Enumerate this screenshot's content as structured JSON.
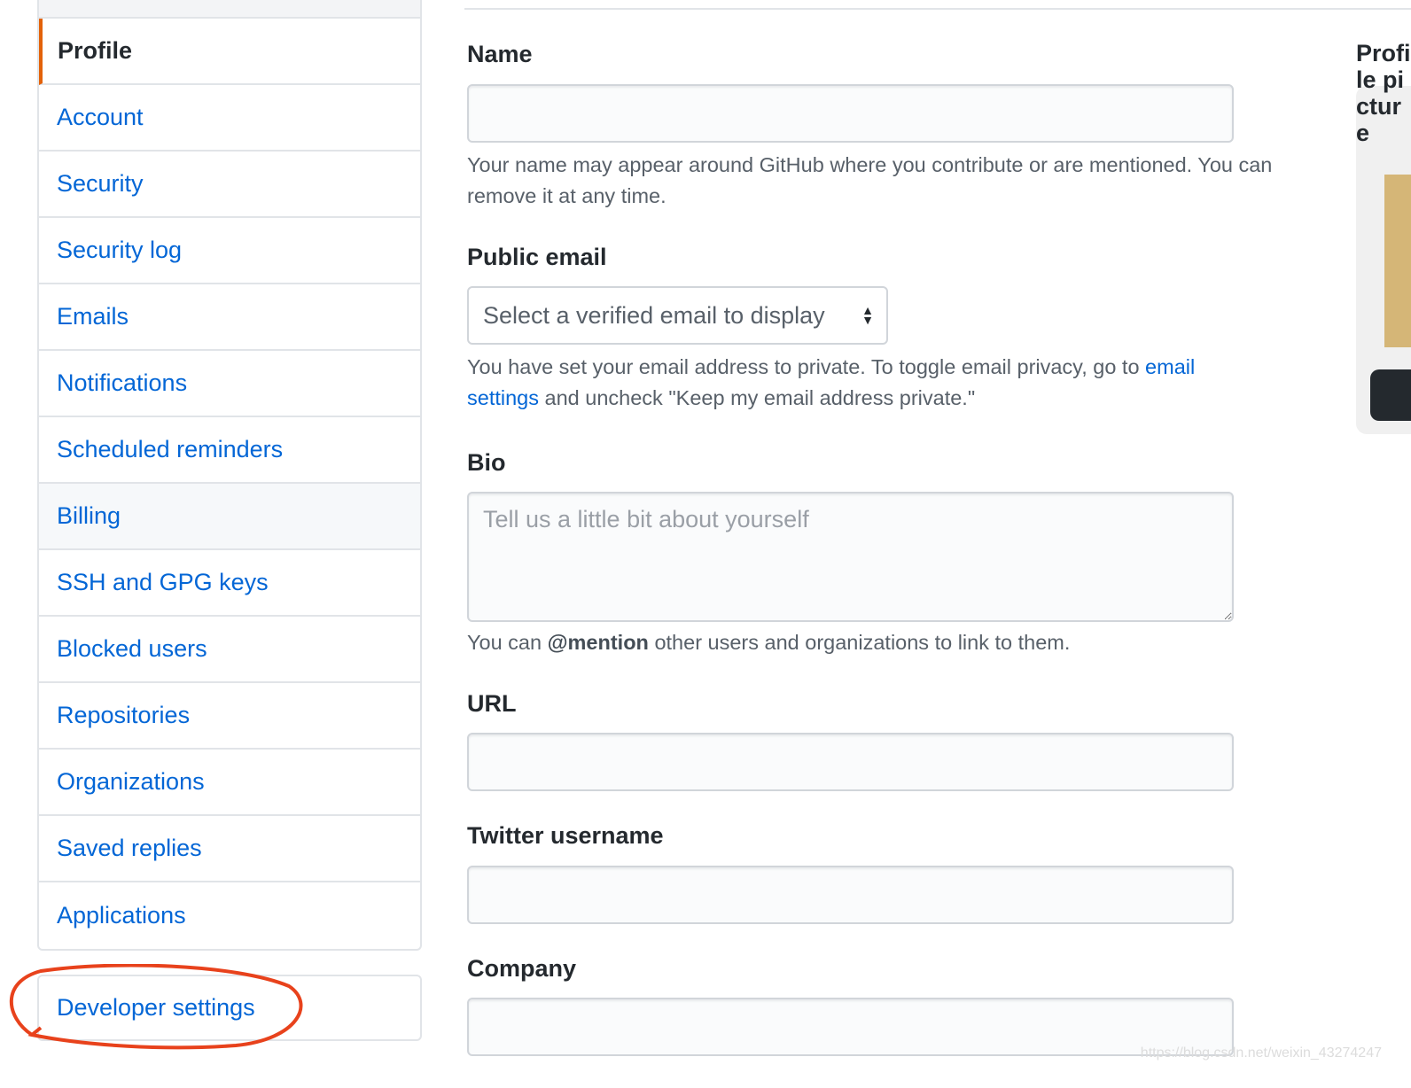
{
  "sidebar": {
    "items": [
      {
        "label": "Profile",
        "selected": true
      },
      {
        "label": "Account"
      },
      {
        "label": "Security"
      },
      {
        "label": "Security log"
      },
      {
        "label": "Emails"
      },
      {
        "label": "Notifications"
      },
      {
        "label": "Scheduled reminders"
      },
      {
        "label": "Billing",
        "hovered": true
      },
      {
        "label": "SSH and GPG keys"
      },
      {
        "label": "Blocked users"
      },
      {
        "label": "Repositories"
      },
      {
        "label": "Organizations"
      },
      {
        "label": "Saved replies"
      },
      {
        "label": "Applications"
      }
    ],
    "developer_settings": "Developer settings"
  },
  "form": {
    "name": {
      "label": "Name",
      "value": "",
      "note": "Your name may appear around GitHub where you contribute or are mentioned. You can remove it at any time."
    },
    "public_email": {
      "label": "Public email",
      "selected": "Select a verified email to display",
      "note_pre": "You have set your email address to private. To toggle email privacy, go to ",
      "note_link": "email settings",
      "note_post": " and uncheck \"Keep my email address private.\""
    },
    "bio": {
      "label": "Bio",
      "placeholder": "Tell us a little bit about yourself",
      "note_pre": "You can ",
      "note_bold": "@mention",
      "note_post": " other users and organizations to link to them."
    },
    "url": {
      "label": "URL",
      "value": ""
    },
    "twitter": {
      "label": "Twitter username",
      "value": ""
    },
    "company": {
      "label": "Company",
      "value": ""
    }
  },
  "right": {
    "title": "Profile picture"
  },
  "watermark": "https://blog.csdn.net/weixin_43274247",
  "colors": {
    "accent": "#e36209",
    "link": "#0366d6",
    "annotation": "#e8421c"
  }
}
